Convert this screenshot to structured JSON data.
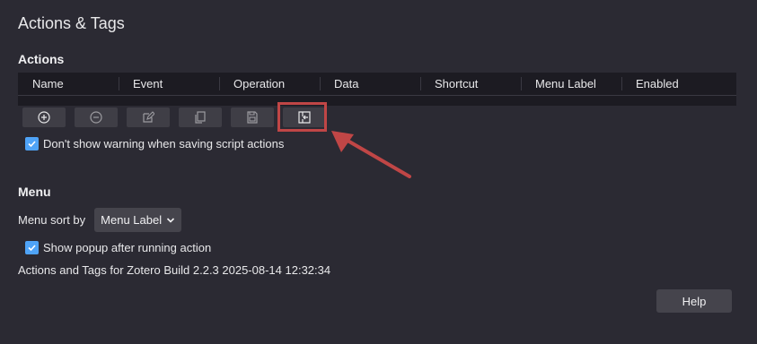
{
  "page": {
    "title": "Actions & Tags"
  },
  "actions": {
    "title": "Actions",
    "columns": [
      "Name",
      "Event",
      "Operation",
      "Data",
      "Shortcut",
      "Menu Label",
      "Enabled"
    ],
    "toolbar": [
      {
        "icon": "add-circle-icon"
      },
      {
        "icon": "remove-circle-icon"
      },
      {
        "icon": "edit-icon"
      },
      {
        "icon": "duplicate-icon"
      },
      {
        "icon": "save-icon"
      },
      {
        "icon": "import-icon"
      }
    ],
    "warning_checkbox": {
      "label": "Don't show warning when saving script actions",
      "checked": true
    }
  },
  "menu": {
    "title": "Menu",
    "sort_label": "Menu sort by",
    "sort_value": "Menu Label",
    "popup_checkbox": {
      "label": "Show popup after running action",
      "checked": true
    }
  },
  "footer": {
    "info": "Actions and Tags for Zotero Build 2.2.3 2025-08-14 12:32:34",
    "help_label": "Help"
  },
  "colors": {
    "highlight": "#c04646",
    "checkbox": "#4fa3f7"
  }
}
